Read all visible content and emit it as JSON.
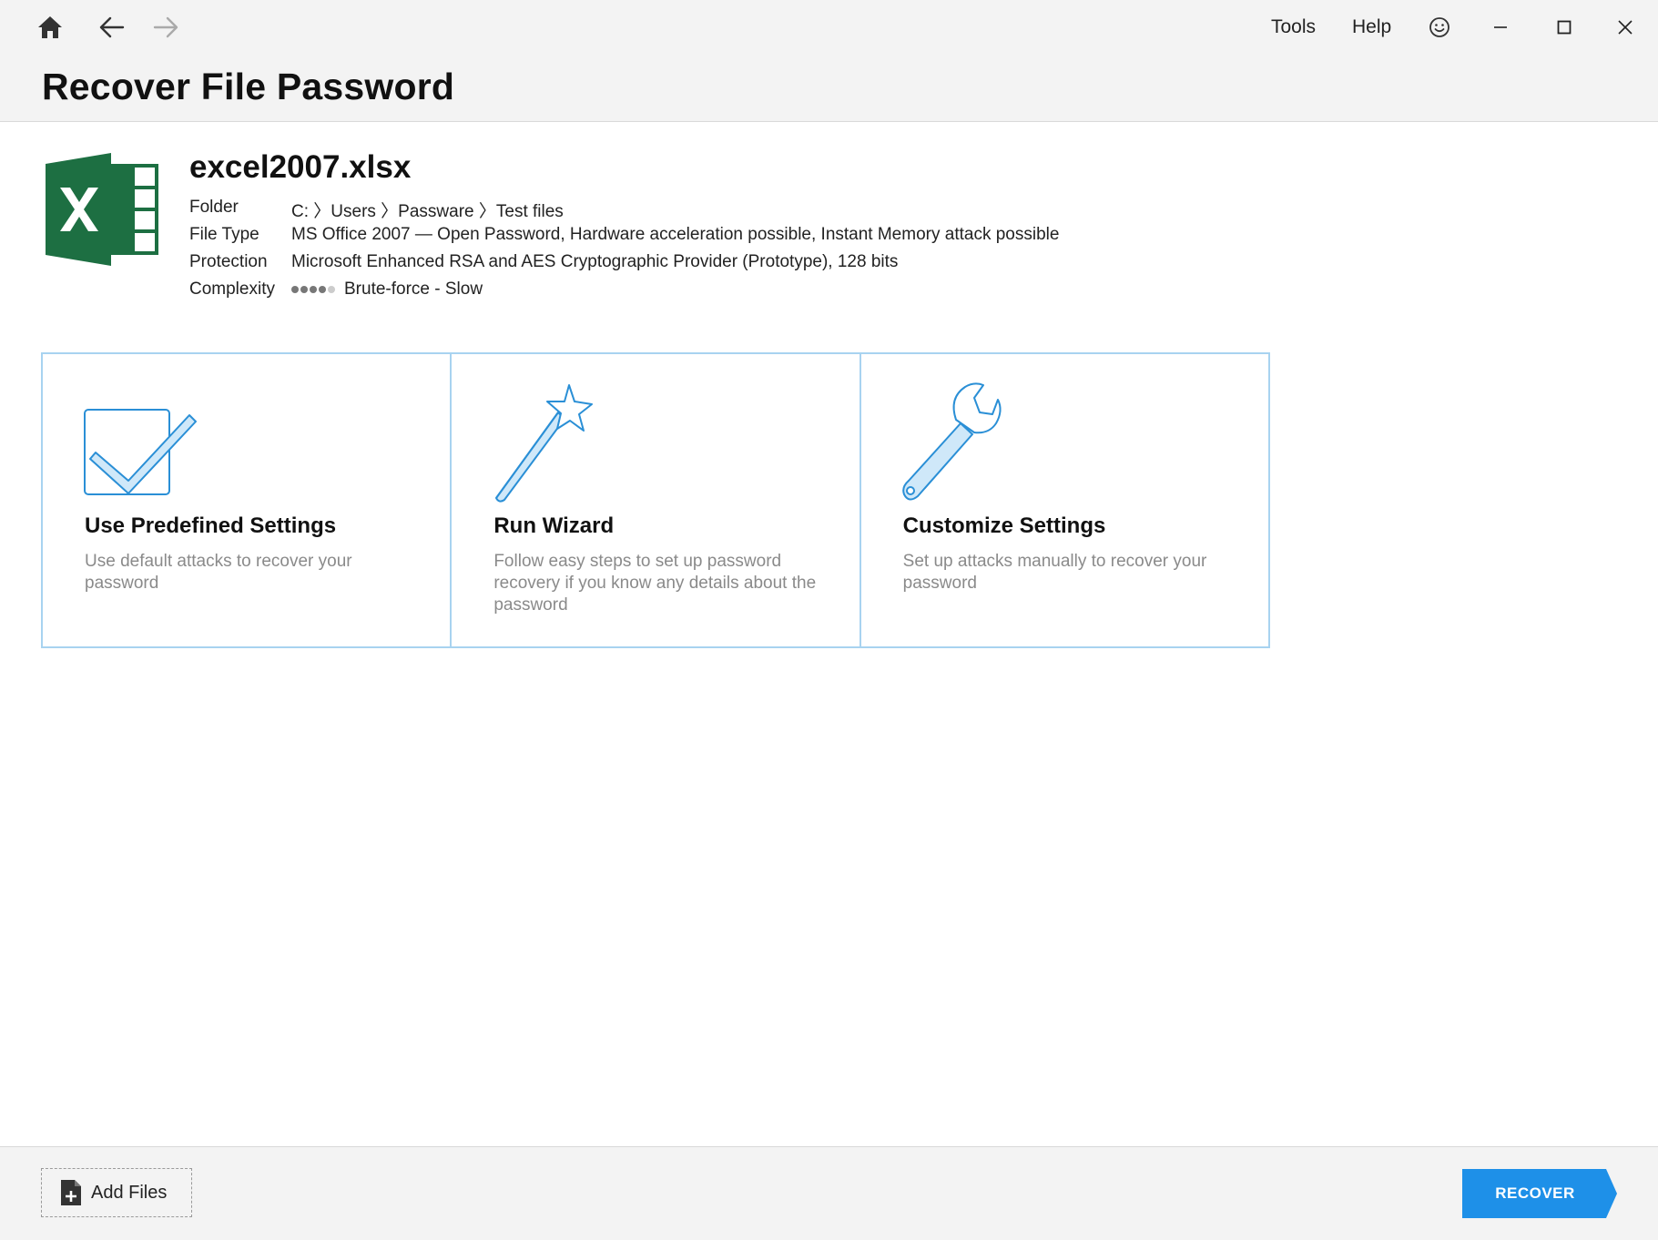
{
  "header": {
    "title": "Recover File Password",
    "menu": {
      "tools": "Tools",
      "help": "Help"
    }
  },
  "file": {
    "name": "excel2007.xlsx",
    "rows": [
      {
        "label": "Folder",
        "value": "C: 〉Users 〉Passware 〉Test files"
      },
      {
        "label": "File Type",
        "value": "MS Office 2007 — Open Password, Hardware acceleration possible, Instant Memory attack possible"
      },
      {
        "label": "Protection",
        "value": "Microsoft Enhanced RSA and AES Cryptographic Provider (Prototype), 128 bits"
      },
      {
        "label": "Complexity",
        "value": "Brute-force - Slow"
      }
    ],
    "complexity_level": 4,
    "complexity_max": 5
  },
  "cards": [
    {
      "title": "Use Predefined Settings",
      "desc": "Use default attacks to recover your password",
      "icon": "checkbox-icon"
    },
    {
      "title": "Run Wizard",
      "desc": "Follow easy steps to set up password recovery if you know any details about the password",
      "icon": "magic-wand-icon"
    },
    {
      "title": "Customize Settings",
      "desc": "Set up attacks manually to recover your password",
      "icon": "wrench-icon"
    }
  ],
  "footer": {
    "add_files": "Add Files",
    "recover": "RECOVER"
  },
  "colors": {
    "accent": "#1e90e8",
    "card_border": "#a8d3f0",
    "excel_green": "#1d6f42",
    "icon_stroke": "#2a8fd6",
    "icon_fill": "#cfe8f9"
  }
}
